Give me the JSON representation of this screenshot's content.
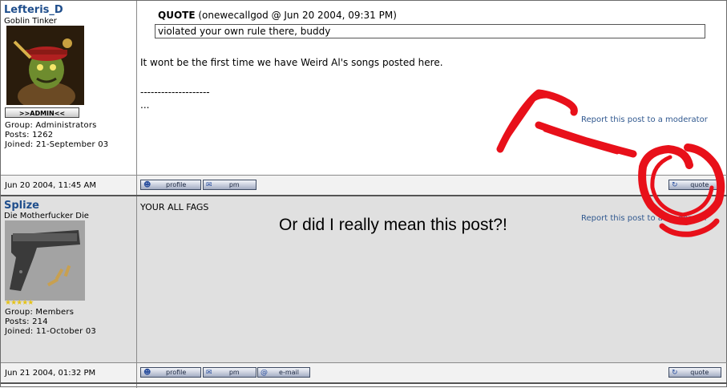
{
  "post1": {
    "username": "Lefteris_D",
    "user_title": "Goblin Tinker",
    "admin_badge": ">>ADMIN<<",
    "group": "Group: Administrators",
    "posts": "Posts: 1262",
    "joined": "Joined: 21-September 03",
    "quote_header_label": "QUOTE",
    "quote_header_meta": "(onewecallgod @ Jun 20 2004, 09:31 PM)",
    "quote_text": "violated your own rule there, buddy",
    "body_line": "It wont be the first time we have Weird Al's songs posted here.",
    "signature_sep": "--------------------",
    "signature_text": "...",
    "report_link": "Report this post to a moderator",
    "date": "Jun 20 2004, 11:45 AM",
    "buttons": {
      "profile": "profile",
      "pm": "pm",
      "quote": "quote"
    }
  },
  "post2": {
    "username": "Splize",
    "user_title": "Die Motherfucker Die",
    "stars": "★★★★★",
    "group": "Group: Members",
    "posts": "Posts: 214",
    "joined": "Joined: 11-October 03",
    "body_line": "YOUR ALL FAGS",
    "report_link": "Report this post to a moderator",
    "date": "Jun 21 2004, 01:32 PM",
    "buttons": {
      "profile": "profile",
      "pm": "pm",
      "email": "e-mail",
      "quote": "quote"
    }
  },
  "overlay_text": "Or did I really mean this post?!",
  "colors": {
    "scribble": "#e8101a",
    "username": "#1f4e8c",
    "alt_row": "#e0e0e0"
  }
}
